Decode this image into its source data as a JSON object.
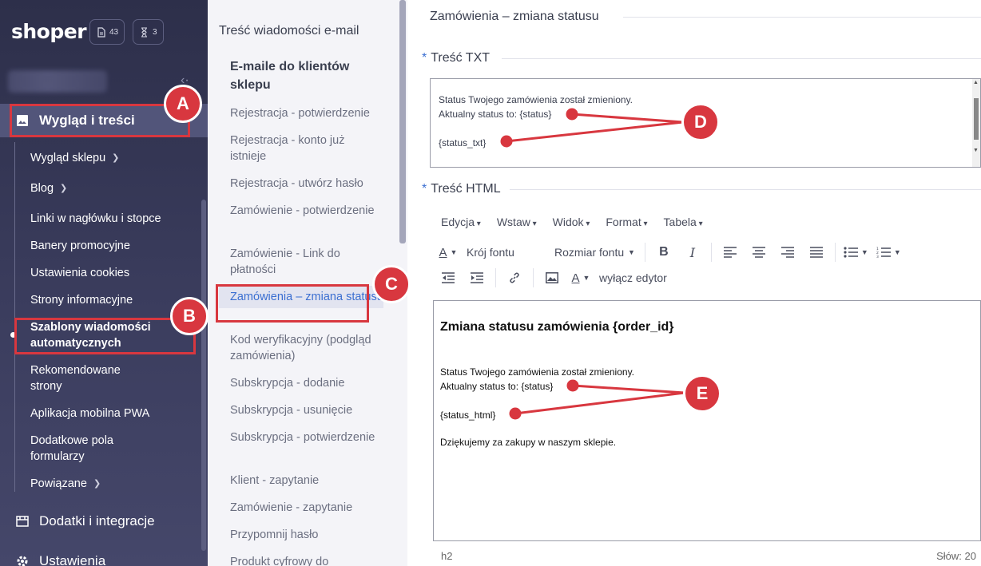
{
  "sidebar": {
    "logo": "shoper",
    "pill_docs": "43",
    "pill_timer": "3",
    "main_active": "Wygląd i treści",
    "items": [
      {
        "label": "Wygląd sklepu",
        "chevron": true
      },
      {
        "label": "Blog",
        "chevron": true
      },
      {
        "label": "Linki w nagłówku i stopce"
      },
      {
        "label": "Banery promocyjne"
      },
      {
        "label": "Ustawienia cookies"
      },
      {
        "label": "Strony informacyjne"
      },
      {
        "label": "Szablony wiadomości automatycznych",
        "active": true
      },
      {
        "label": "Rekomendowane strony"
      },
      {
        "label": "Aplikacja mobilna PWA"
      },
      {
        "label": "Dodatkowe pola formularzy"
      },
      {
        "label": "Powiązane",
        "chevron": true
      }
    ],
    "main_addons": "Dodatki i integracje",
    "main_settings": "Ustawienia"
  },
  "middle": {
    "title": "Treść wiadomości e-mail",
    "subtitle": "E-maile do klientów sklepu",
    "items": [
      "Rejestracja - potwierdzenie",
      "Rejestracja - konto już istnieje",
      "Rejestracja - utwórz hasło",
      "Zamówienie - potwierdzenie",
      "Zamówienie - Link do płatności",
      "Zamówienia – zmiana statusu",
      "Kod weryfikacyjny (podgląd zamówienia)",
      "Subskrypcja - dodanie",
      "Subskrypcja - usunięcie",
      "Subskrypcja - potwierdzenie",
      "Klient - zapytanie",
      "Zamówienie - zapytanie",
      "Przypomnij hasło",
      "Produkt cyfrowy do"
    ]
  },
  "main": {
    "title": "Zamówienia – zmiana statusu",
    "txt_label": "Treść TXT",
    "txt_lines": [
      "Status Twojego zamówienia został zmieniony.",
      "Aktualny status to: {status}",
      "{status_txt}"
    ],
    "html_label": "Treść HTML",
    "menus": [
      "Edycja",
      "Wstaw",
      "Widok",
      "Format",
      "Tabela"
    ],
    "font_family": "Krój fontu",
    "font_size": "Rozmiar fontu",
    "disable_editor": "wyłącz edytor",
    "html_heading": "Zmiana statusu zamówienia {order_id}",
    "html_lines": [
      "Status Twojego zamówienia został zmieniony.",
      "Aktualny status to: {status}",
      "{status_html}",
      "Dziękujemy za zakupy w naszym sklepie."
    ],
    "status_path": "h2",
    "word_count": "Słów: 20"
  },
  "annotations": {
    "a": "A",
    "b": "B",
    "c": "C",
    "d": "D",
    "e": "E"
  },
  "colors": {
    "accent": "#d8373f",
    "link": "#3b6fd1",
    "sidebar": "#2d2f4a"
  }
}
